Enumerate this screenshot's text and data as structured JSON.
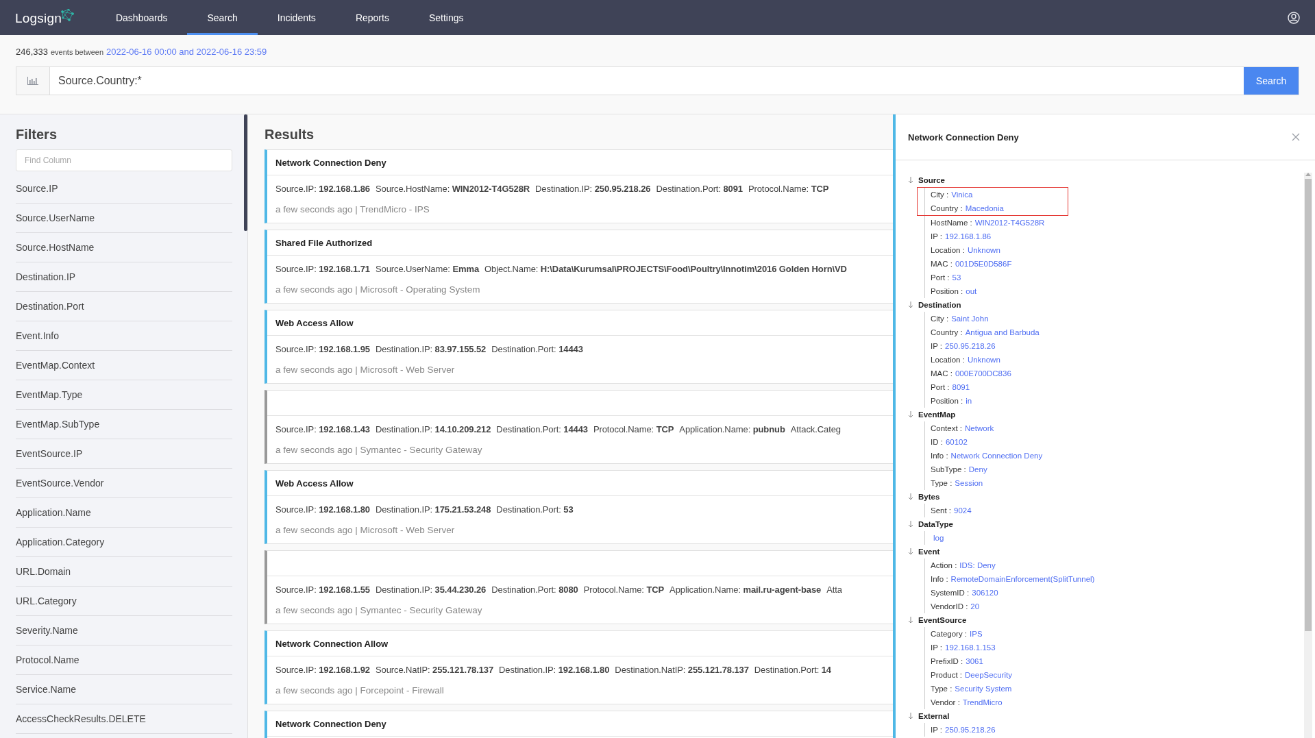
{
  "nav": {
    "logo": "Logsign",
    "items": [
      {
        "label": "Dashboards",
        "selected": false
      },
      {
        "label": "Search",
        "selected": true
      },
      {
        "label": "Incidents",
        "selected": false
      },
      {
        "label": "Reports",
        "selected": false
      },
      {
        "label": "Settings",
        "selected": false
      }
    ]
  },
  "summary": {
    "count": "246,333",
    "label": "events between",
    "range": "2022-06-16 00:00 and 2022-06-16 23:59"
  },
  "search": {
    "query": "Source.Country:*",
    "button": "Search"
  },
  "filters": {
    "title": "Filters",
    "placeholder": "Find Column",
    "items": [
      "Source.IP",
      "Source.UserName",
      "Source.HostName",
      "Destination.IP",
      "Destination.Port",
      "Event.Info",
      "EventMap.Context",
      "EventMap.Type",
      "EventMap.SubType",
      "EventSource.IP",
      "EventSource.Vendor",
      "Application.Name",
      "Application.Category",
      "URL.Domain",
      "URL.Category",
      "Severity.Name",
      "Protocol.Name",
      "Service.Name",
      "AccessCheckResults.DELETE"
    ]
  },
  "results": {
    "title": "Results",
    "events": [
      {
        "title": "Network Connection Deny",
        "fields": [
          {
            "name": "Source.IP:",
            "value": "192.168.1.86"
          },
          {
            "name": "Source.HostName:",
            "value": "WIN2012-T4G528R"
          },
          {
            "name": "Destination.IP:",
            "value": "250.95.218.26"
          },
          {
            "name": "Destination.Port:",
            "value": "8091"
          },
          {
            "name": "Protocol.Name:",
            "value": "TCP"
          }
        ],
        "meta": "a few seconds ago | TrendMicro - IPS"
      },
      {
        "title": "Shared File Authorized",
        "fields": [
          {
            "name": "Source.IP:",
            "value": "192.168.1.71"
          },
          {
            "name": "Source.UserName:",
            "value": "Emma"
          },
          {
            "name": "Object.Name:",
            "value": "H:\\Data\\Kurumsal\\PROJECTS\\Food\\Poultry\\Innotim\\2016 Golden Horn\\VD"
          }
        ],
        "meta": "a few seconds ago | Microsoft - Operating System"
      },
      {
        "title": "Web Access Allow",
        "fields": [
          {
            "name": "Source.IP:",
            "value": "192.168.1.95"
          },
          {
            "name": "Destination.IP:",
            "value": "83.97.155.52"
          },
          {
            "name": "Destination.Port:",
            "value": "14443"
          }
        ],
        "meta": "a few seconds ago | Microsoft - Web Server"
      },
      {
        "fields": [
          {
            "name": "Source.IP:",
            "value": "192.168.1.43"
          },
          {
            "name": "Destination.IP:",
            "value": "14.10.209.212"
          },
          {
            "name": "Destination.Port:",
            "value": "14443"
          },
          {
            "name": "Protocol.Name:",
            "value": "TCP"
          },
          {
            "name": "Application.Name:",
            "value": "pubnub"
          },
          {
            "name": "Attack.Categ"
          }
        ],
        "meta": "a few seconds ago | Symantec - Security Gateway"
      },
      {
        "title": "Web Access Allow",
        "fields": [
          {
            "name": "Source.IP:",
            "value": "192.168.1.80"
          },
          {
            "name": "Destination.IP:",
            "value": "175.21.53.248"
          },
          {
            "name": "Destination.Port:",
            "value": "53"
          }
        ],
        "meta": "a few seconds ago | Microsoft - Web Server"
      },
      {
        "fields": [
          {
            "name": "Source.IP:",
            "value": "192.168.1.55"
          },
          {
            "name": "Destination.IP:",
            "value": "35.44.230.26"
          },
          {
            "name": "Destination.Port:",
            "value": "8080"
          },
          {
            "name": "Protocol.Name:",
            "value": "TCP"
          },
          {
            "name": "Application.Name:",
            "value": "mail.ru-agent-base"
          },
          {
            "name": "Atta"
          }
        ],
        "meta": "a few seconds ago | Symantec - Security Gateway"
      },
      {
        "title": "Network Connection Allow",
        "fields": [
          {
            "name": "Source.IP:",
            "value": "192.168.1.92"
          },
          {
            "name": "Source.NatIP:",
            "value": "255.121.78.137"
          },
          {
            "name": "Destination.IP:",
            "value": "192.168.1.80"
          },
          {
            "name": "Destination.NatIP:",
            "value": "255.121.78.137"
          },
          {
            "name": "Destination.Port:",
            "value": "14"
          }
        ],
        "meta": "a few seconds ago | Forcepoint - Firewall"
      },
      {
        "title": "Network Connection Deny"
      }
    ]
  },
  "detail": {
    "title": "Network Connection Deny",
    "groups": [
      {
        "name": "Source",
        "children": [
          {
            "key": "City :",
            "value": "Vinica",
            "highlighted": true
          },
          {
            "key": "Country :",
            "value": "Macedonia",
            "highlighted": true
          },
          {
            "key": "HostName :",
            "value": "WIN2012-T4G528R",
            "highlighted": false
          },
          {
            "key": "IP :",
            "value": "192.168.1.86",
            "highlighted": false
          },
          {
            "key": "Location :",
            "value": "Unknown",
            "highlighted": false
          },
          {
            "key": "MAC :",
            "value": "001D5E0D586F",
            "highlighted": false
          },
          {
            "key": "Port :",
            "value": "53",
            "highlighted": false
          },
          {
            "key": "Position :",
            "value": "out",
            "highlighted": false
          }
        ]
      },
      {
        "name": "Destination",
        "children": [
          {
            "key": "City :",
            "value": "Saint John",
            "highlighted": false
          },
          {
            "key": "Country :",
            "value": "Antigua and Barbuda",
            "highlighted": false
          },
          {
            "key": "IP :",
            "value": "250.95.218.26",
            "highlighted": false
          },
          {
            "key": "Location :",
            "value": "Unknown",
            "highlighted": false
          },
          {
            "key": "MAC :",
            "value": "000E700DC836",
            "highlighted": false
          },
          {
            "key": "Port :",
            "value": "8091",
            "highlighted": false
          },
          {
            "key": "Position :",
            "value": "in",
            "highlighted": false
          }
        ]
      },
      {
        "name": "EventMap",
        "children": [
          {
            "key": "Context :",
            "value": "Network",
            "highlighted": false
          },
          {
            "key": "ID :",
            "value": "60102",
            "highlighted": false
          },
          {
            "key": "Info :",
            "value": "Network Connection Deny",
            "highlighted": false
          },
          {
            "key": "SubType :",
            "value": "Deny",
            "highlighted": false
          },
          {
            "key": "Type :",
            "value": "Session",
            "highlighted": false
          }
        ]
      },
      {
        "name": "Bytes",
        "children": [
          {
            "key": "Sent :",
            "value": "9024",
            "highlighted": false
          }
        ]
      },
      {
        "name": "DataType",
        "children": [
          {
            "value": "log",
            "highlighted": false
          }
        ]
      },
      {
        "name": "Event",
        "children": [
          {
            "key": "Action :",
            "value": "IDS: Deny",
            "highlighted": false
          },
          {
            "key": "Info :",
            "value": "RemoteDomainEnforcement(SplitTunnel)",
            "highlighted": false
          },
          {
            "key": "SystemID :",
            "value": "306120",
            "highlighted": false
          },
          {
            "key": "VendorID :",
            "value": "20",
            "highlighted": false
          }
        ]
      },
      {
        "name": "EventSource",
        "children": [
          {
            "key": "Category :",
            "value": "IPS",
            "highlighted": false
          },
          {
            "key": "IP :",
            "value": "192.168.1.153",
            "highlighted": false
          },
          {
            "key": "PrefixID :",
            "value": "3061",
            "highlighted": false
          },
          {
            "key": "Product :",
            "value": "DeepSecurity",
            "highlighted": false
          },
          {
            "key": "Type :",
            "value": "Security System",
            "highlighted": false
          },
          {
            "key": "Vendor :",
            "value": "TrendMicro",
            "highlighted": false
          }
        ]
      },
      {
        "name": "External",
        "children": [
          {
            "key": "IP :",
            "value": "250.95.218.26",
            "highlighted": false
          }
        ]
      }
    ]
  }
}
